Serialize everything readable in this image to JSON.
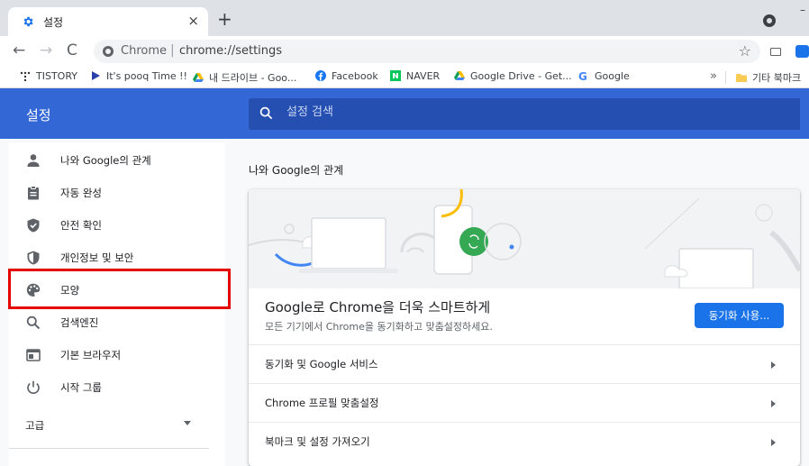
{
  "tab": {
    "title": "설정",
    "close": "×",
    "new_tab": "+"
  },
  "toolbar": {
    "back": "←",
    "forward": "→",
    "reload": "C",
    "site_label": "Chrome",
    "separator": "|",
    "url": "chrome://settings",
    "star": "☆"
  },
  "bookmarks": {
    "items": [
      {
        "label": "TISTORY",
        "icon": "tistory-icon"
      },
      {
        "label": "It's pooq Time !!",
        "icon": "pooq-icon"
      },
      {
        "label": "내 드라이브 - Goo...",
        "icon": "google-drive-icon"
      },
      {
        "label": "Facebook",
        "icon": "facebook-icon"
      },
      {
        "label": "NAVER",
        "icon": "naver-icon"
      },
      {
        "label": "Google Drive - Get...",
        "icon": "google-drive-icon"
      },
      {
        "label": "Google",
        "icon": "google-icon"
      }
    ],
    "more": "»",
    "other_folder": "기타 북마크"
  },
  "header": {
    "title": "설정",
    "search_placeholder": "설정 검색"
  },
  "sidebar": {
    "items": [
      {
        "label": "나와 Google의 관계",
        "icon": "person-icon"
      },
      {
        "label": "자동 완성",
        "icon": "clipboard-icon"
      },
      {
        "label": "안전 확인",
        "icon": "shield-check-icon"
      },
      {
        "label": "개인정보 및 보안",
        "icon": "shield-icon"
      },
      {
        "label": "모양",
        "icon": "palette-icon"
      },
      {
        "label": "검색엔진",
        "icon": "search-icon"
      },
      {
        "label": "기본 브라우저",
        "icon": "browser-icon"
      },
      {
        "label": "시작 그룹",
        "icon": "power-icon"
      }
    ],
    "advanced": "고급"
  },
  "main": {
    "section_title": "나와 Google의 관계",
    "promo_title": "Google로 Chrome을 더욱 스마트하게",
    "promo_desc": "모든 기기에서 Chrome을 동기화하고 맞춤설정하세요.",
    "sync_button": "동기화 사용...",
    "rows": [
      {
        "label": "동기화 및 Google 서비스"
      },
      {
        "label": "Chrome 프로필 맞춤설정"
      },
      {
        "label": "북마크 및 설정 가져오기"
      }
    ]
  },
  "colors": {
    "header_blue": "#3367d6",
    "search_bg": "#254fb1",
    "button_blue": "#1a73e8",
    "highlight_red": "#e50000"
  }
}
